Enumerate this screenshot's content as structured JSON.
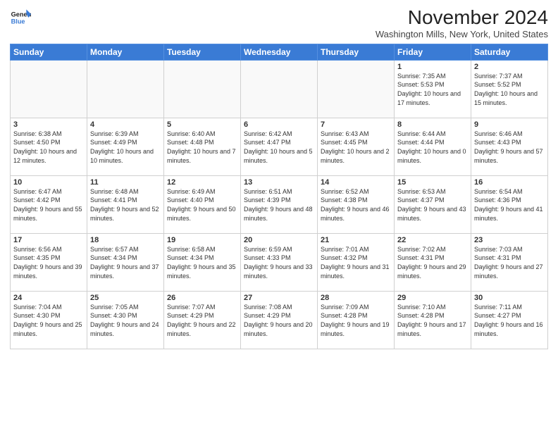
{
  "logo": {
    "line1": "General",
    "line2": "Blue"
  },
  "title": "November 2024",
  "location": "Washington Mills, New York, United States",
  "weekdays": [
    "Sunday",
    "Monday",
    "Tuesday",
    "Wednesday",
    "Thursday",
    "Friday",
    "Saturday"
  ],
  "weeks": [
    [
      {
        "day": "",
        "info": ""
      },
      {
        "day": "",
        "info": ""
      },
      {
        "day": "",
        "info": ""
      },
      {
        "day": "",
        "info": ""
      },
      {
        "day": "",
        "info": ""
      },
      {
        "day": "1",
        "info": "Sunrise: 7:35 AM\nSunset: 5:53 PM\nDaylight: 10 hours and 17 minutes."
      },
      {
        "day": "2",
        "info": "Sunrise: 7:37 AM\nSunset: 5:52 PM\nDaylight: 10 hours and 15 minutes."
      }
    ],
    [
      {
        "day": "3",
        "info": "Sunrise: 6:38 AM\nSunset: 4:50 PM\nDaylight: 10 hours and 12 minutes."
      },
      {
        "day": "4",
        "info": "Sunrise: 6:39 AM\nSunset: 4:49 PM\nDaylight: 10 hours and 10 minutes."
      },
      {
        "day": "5",
        "info": "Sunrise: 6:40 AM\nSunset: 4:48 PM\nDaylight: 10 hours and 7 minutes."
      },
      {
        "day": "6",
        "info": "Sunrise: 6:42 AM\nSunset: 4:47 PM\nDaylight: 10 hours and 5 minutes."
      },
      {
        "day": "7",
        "info": "Sunrise: 6:43 AM\nSunset: 4:45 PM\nDaylight: 10 hours and 2 minutes."
      },
      {
        "day": "8",
        "info": "Sunrise: 6:44 AM\nSunset: 4:44 PM\nDaylight: 10 hours and 0 minutes."
      },
      {
        "day": "9",
        "info": "Sunrise: 6:46 AM\nSunset: 4:43 PM\nDaylight: 9 hours and 57 minutes."
      }
    ],
    [
      {
        "day": "10",
        "info": "Sunrise: 6:47 AM\nSunset: 4:42 PM\nDaylight: 9 hours and 55 minutes."
      },
      {
        "day": "11",
        "info": "Sunrise: 6:48 AM\nSunset: 4:41 PM\nDaylight: 9 hours and 52 minutes."
      },
      {
        "day": "12",
        "info": "Sunrise: 6:49 AM\nSunset: 4:40 PM\nDaylight: 9 hours and 50 minutes."
      },
      {
        "day": "13",
        "info": "Sunrise: 6:51 AM\nSunset: 4:39 PM\nDaylight: 9 hours and 48 minutes."
      },
      {
        "day": "14",
        "info": "Sunrise: 6:52 AM\nSunset: 4:38 PM\nDaylight: 9 hours and 46 minutes."
      },
      {
        "day": "15",
        "info": "Sunrise: 6:53 AM\nSunset: 4:37 PM\nDaylight: 9 hours and 43 minutes."
      },
      {
        "day": "16",
        "info": "Sunrise: 6:54 AM\nSunset: 4:36 PM\nDaylight: 9 hours and 41 minutes."
      }
    ],
    [
      {
        "day": "17",
        "info": "Sunrise: 6:56 AM\nSunset: 4:35 PM\nDaylight: 9 hours and 39 minutes."
      },
      {
        "day": "18",
        "info": "Sunrise: 6:57 AM\nSunset: 4:34 PM\nDaylight: 9 hours and 37 minutes."
      },
      {
        "day": "19",
        "info": "Sunrise: 6:58 AM\nSunset: 4:34 PM\nDaylight: 9 hours and 35 minutes."
      },
      {
        "day": "20",
        "info": "Sunrise: 6:59 AM\nSunset: 4:33 PM\nDaylight: 9 hours and 33 minutes."
      },
      {
        "day": "21",
        "info": "Sunrise: 7:01 AM\nSunset: 4:32 PM\nDaylight: 9 hours and 31 minutes."
      },
      {
        "day": "22",
        "info": "Sunrise: 7:02 AM\nSunset: 4:31 PM\nDaylight: 9 hours and 29 minutes."
      },
      {
        "day": "23",
        "info": "Sunrise: 7:03 AM\nSunset: 4:31 PM\nDaylight: 9 hours and 27 minutes."
      }
    ],
    [
      {
        "day": "24",
        "info": "Sunrise: 7:04 AM\nSunset: 4:30 PM\nDaylight: 9 hours and 25 minutes."
      },
      {
        "day": "25",
        "info": "Sunrise: 7:05 AM\nSunset: 4:30 PM\nDaylight: 9 hours and 24 minutes."
      },
      {
        "day": "26",
        "info": "Sunrise: 7:07 AM\nSunset: 4:29 PM\nDaylight: 9 hours and 22 minutes."
      },
      {
        "day": "27",
        "info": "Sunrise: 7:08 AM\nSunset: 4:29 PM\nDaylight: 9 hours and 20 minutes."
      },
      {
        "day": "28",
        "info": "Sunrise: 7:09 AM\nSunset: 4:28 PM\nDaylight: 9 hours and 19 minutes."
      },
      {
        "day": "29",
        "info": "Sunrise: 7:10 AM\nSunset: 4:28 PM\nDaylight: 9 hours and 17 minutes."
      },
      {
        "day": "30",
        "info": "Sunrise: 7:11 AM\nSunset: 4:27 PM\nDaylight: 9 hours and 16 minutes."
      }
    ]
  ]
}
